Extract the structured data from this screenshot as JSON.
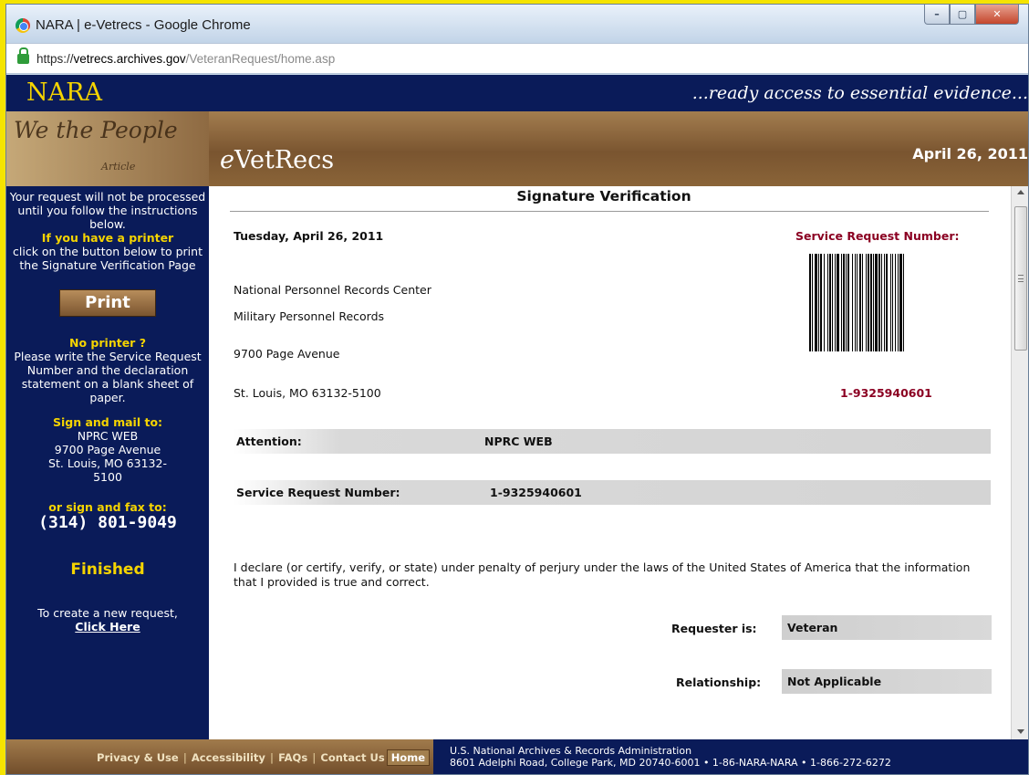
{
  "window": {
    "title": "NARA | e-Vetrecs - Google Chrome",
    "controls": {
      "minimize": "–",
      "maximize": "▢",
      "close": "✕"
    }
  },
  "address": {
    "scheme": "https://",
    "host": "vetrecs.archives.gov",
    "path": "/VeteranRequest/home.asp"
  },
  "site": {
    "logo": "NARA",
    "tagline": "...ready access to essential evidence...",
    "we_the_people": "We the People",
    "we_the_people_sub": "Article",
    "app_name_prefix": "e",
    "app_name_rest": "VetRecs",
    "date": "April 26, 2011"
  },
  "sidebar": {
    "intro": "Your request will not be processed until you follow the instructions below.",
    "printer_heading": "If you have a printer",
    "printer_text": "click on the button below to print the Signature Verification Page",
    "print_button": "Print",
    "no_printer_heading": "No printer ?",
    "no_printer_text": "Please write the Service Request Number and the declaration statement on a blank sheet of paper.",
    "sign_mail_heading": "Sign and mail to:",
    "mail_name": "NPRC WEB",
    "mail_street": "9700 Page Avenue",
    "mail_city": "St. Louis, MO 63132-5100",
    "sign_fax_heading": "or sign and fax to:",
    "fax_number": "(314) 801-9049",
    "finished": "Finished",
    "new_request_text": "To create a new request,",
    "click_here": "Click Here"
  },
  "content": {
    "title": "Signature Verification",
    "date": "Tuesday, April 26, 2011",
    "srn_label_top": "Service Request Number:",
    "address": {
      "line1": "National Personnel Records Center",
      "line2": "Military Personnel Records",
      "line3": "9700 Page Avenue",
      "line4": "St. Louis, MO 63132-5100"
    },
    "srn_value_top": "1-9325940601",
    "attention_label": "Attention:",
    "attention_value": "NPRC WEB",
    "srn_label": "Service Request Number:",
    "srn_value": "1-9325940601",
    "declaration": "I declare (or certify, verify, or state) under penalty of perjury under the laws of the United States of America that the information that I provided is true and correct.",
    "requester_label": "Requester is:",
    "requester_value": "Veteran",
    "relationship_label": "Relationship:",
    "relationship_value": "Not Applicable"
  },
  "footer": {
    "links": [
      "Privacy & Use",
      "Accessibility",
      "FAQs",
      "Contact Us",
      "Home"
    ],
    "org_line1": "U.S. National Archives & Records Administration",
    "org_line2": "8601 Adelphi Road, College Park, MD 20740-6001  •  1-86-NARA-NARA  •  1-866-272-6272"
  },
  "colors": {
    "nara_navy": "#0a1b59",
    "nara_gold": "#f5d400",
    "maroon": "#8b0022",
    "desktop_yellow": "#f5e400"
  },
  "icons": {
    "browser": "chrome-logo-icon",
    "secure": "lock-icon"
  }
}
